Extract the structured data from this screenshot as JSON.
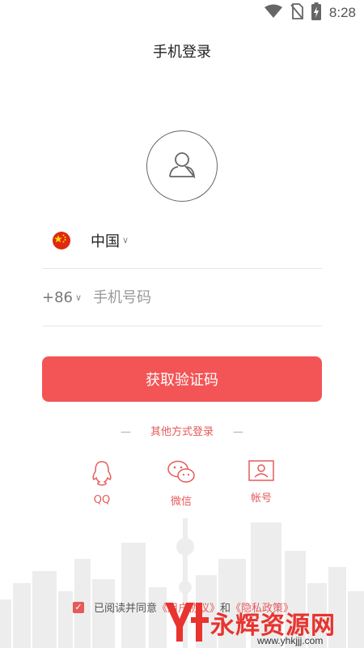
{
  "status_bar": {
    "time": "8:28",
    "icons": [
      "wifi-icon",
      "no-sim-icon",
      "battery-charging-icon"
    ]
  },
  "header": {
    "title": "手机登录"
  },
  "form": {
    "country": {
      "name": "中国",
      "flag": "cn-flag-icon"
    },
    "phone": {
      "dial_code": "+86",
      "placeholder": "手机号码",
      "value": ""
    },
    "submit_label": "获取验证码"
  },
  "other_login": {
    "title": "其他方式登录",
    "options": [
      {
        "label": "QQ",
        "icon": "qq-icon"
      },
      {
        "label": "微信",
        "icon": "wechat-icon"
      },
      {
        "label": "帐号",
        "icon": "account-icon"
      }
    ]
  },
  "agreement": {
    "prefix": "已阅读并同意",
    "link1": "《用户协议》",
    "connector": "和",
    "link2": "《隐私政策》",
    "checked": true
  },
  "watermark": {
    "text": "永辉资源网",
    "url": "www.yhkjjj.com"
  },
  "colors": {
    "accent": "#f35455",
    "link": "#e65a5a"
  }
}
